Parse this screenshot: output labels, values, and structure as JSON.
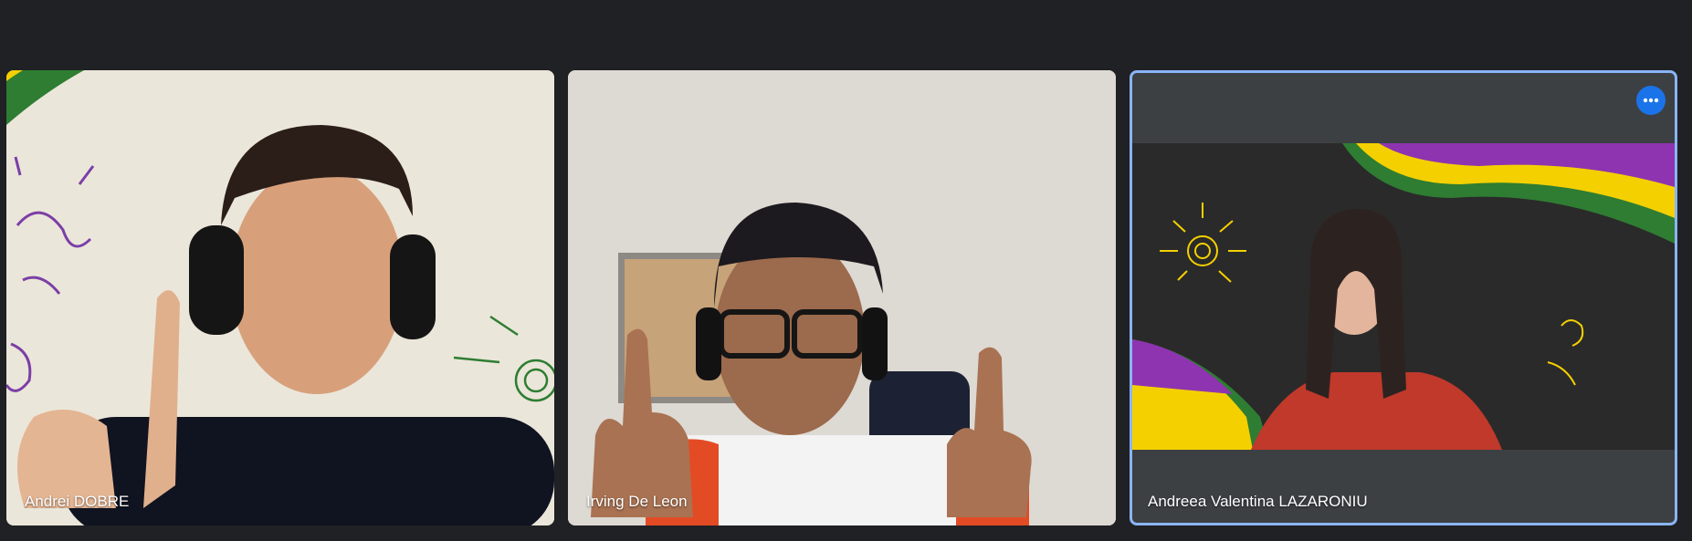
{
  "participants": [
    {
      "name": "Andrei DOBRE"
    },
    {
      "name": "Irving De Leon"
    },
    {
      "name": "Andreea Valentina LAZARONIU",
      "active_speaker": true
    }
  ],
  "colors": {
    "background": "#202124",
    "tile_bg": "#3c4043",
    "active_border": "#8ab4f8",
    "more_button": "#1a73e8"
  },
  "icons": {
    "more_options": "more-horizontal-icon"
  }
}
